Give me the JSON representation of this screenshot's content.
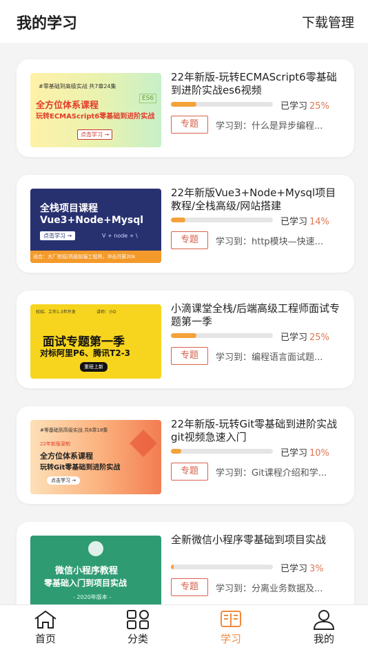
{
  "header": {
    "title": "我的学习",
    "download": "下载管理"
  },
  "common": {
    "learned_label": "已学习",
    "tag_label": "专题",
    "progress_prefix": "学习到："
  },
  "courses": [
    {
      "title": "22年新版-玩转ECMAScript6零基础到进阶实战es6视频",
      "progress": "25%",
      "progress_value": 25,
      "last": "学习到：什么是异步编程...",
      "thumb": {
        "top": "#零基础到高级实战  共7章24集",
        "line1": "全方位体系课程",
        "line2": "玩转ECMAScript6零基础到进阶实战",
        "btn": "点击学习 →",
        "badge": "ES6"
      }
    },
    {
      "title": "22年新版Vue3+Node+Mysql项目教程/全栈高级/网站搭建",
      "progress": "14%",
      "progress_value": 14,
      "last": "学习到：http模块—快速...",
      "thumb": {
        "line1": "全栈项目课程",
        "line2": "Vue3+Node+Mysql",
        "btn": "点击学习 →",
        "bottom": "适合：大厂校招/高级前端工程师，冲击月薪20k",
        "logos": "V + node + \\"
      }
    },
    {
      "title": "小滴课堂全栈/后端高级工程师面试专题第一季",
      "progress": "25%",
      "progress_value": 25,
      "last": "学习到：编程语言面试题...",
      "thumb": {
        "top_left": "校招、工作1-3年开发",
        "top_right": "讲师：小D",
        "line1": "面试专题第一季",
        "line2": "对标阿里P6、腾讯T2-3",
        "btn": "重磅上新"
      }
    },
    {
      "title": "22年新版-玩转Git零基础到进阶实战 git视频急速入门",
      "progress": "10%",
      "progress_value": 10,
      "last": "学习到：Git课程介绍和学...",
      "thumb": {
        "top": "#零基础到高级实战  共6章18集",
        "badge": "22年新版录制",
        "line1": "全方位体系课程",
        "line2": "玩转Git零基础到进阶实战",
        "btn": "点击学习 →"
      }
    },
    {
      "title": "全新微信小程序零基础到项目实战",
      "progress": "3%",
      "progress_value": 3,
      "last": "学习到：分离业务数据及...",
      "thumb": {
        "line1": "微信小程序教程",
        "line2": "零基础入门到项目实战",
        "bottom": "- 2020年版本 -"
      }
    }
  ],
  "tabbar": [
    {
      "label": "首页",
      "icon": "home-icon"
    },
    {
      "label": "分类",
      "icon": "category-icon"
    },
    {
      "label": "学习",
      "icon": "book-icon",
      "active": true
    },
    {
      "label": "我的",
      "icon": "user-icon"
    }
  ],
  "colors": {
    "accent": "#f08a3c",
    "tag": "#d9604c",
    "progress": "#f4a23a"
  }
}
